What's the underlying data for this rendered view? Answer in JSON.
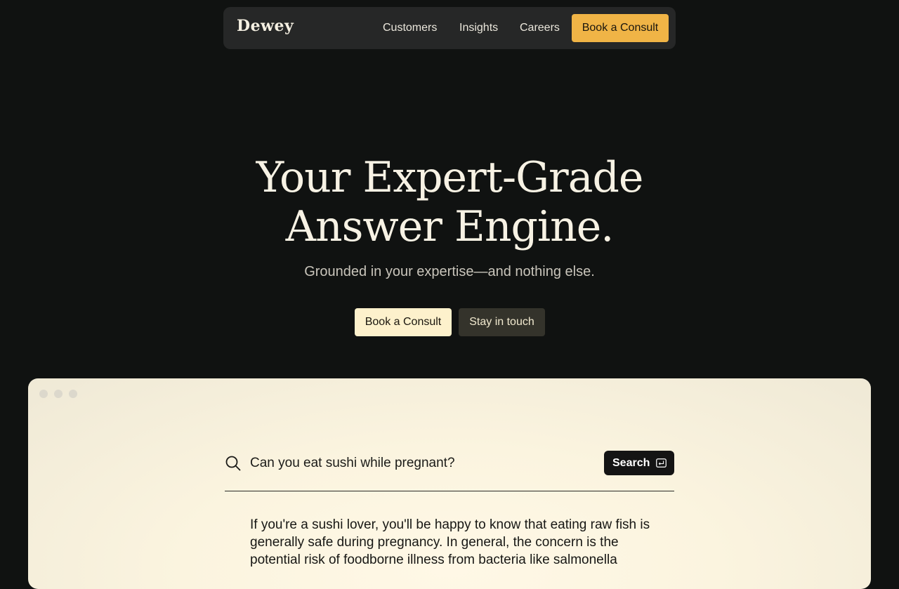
{
  "nav": {
    "logo": "Dewey",
    "links": [
      "Customers",
      "Insights",
      "Careers"
    ],
    "cta": "Book a Consult"
  },
  "hero": {
    "title_line1": "Your Expert-Grade",
    "title_line2": "Answer Engine.",
    "subtitle": "Grounded in your expertise—and nothing else.",
    "primary_button": "Book a Consult",
    "secondary_button": "Stay in touch"
  },
  "demo": {
    "search_query": "Can you eat sushi while pregnant?",
    "search_button": "Search",
    "search_icon": "search-icon",
    "enter_icon": "enter-key-icon",
    "answer": "If you're a sushi lover, you'll be happy to know that eating raw fish is generally safe during pregnancy. In general, the concern is the potential risk of foodborne illness from bacteria like salmonella"
  },
  "colors": {
    "page_bg": "#101211",
    "nav_bg": "#262727",
    "accent": "#f0b446",
    "primary_btn": "#fdf1cc",
    "secondary_btn": "#34332b"
  }
}
